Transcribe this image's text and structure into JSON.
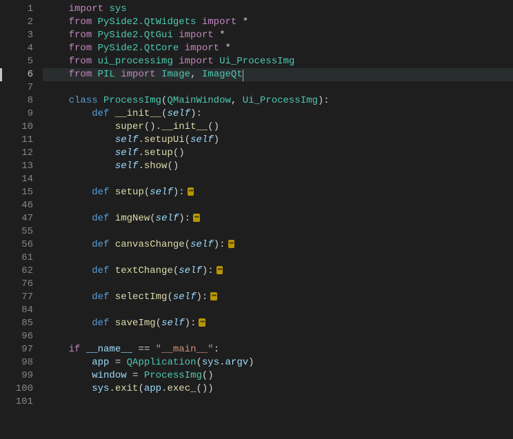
{
  "line_numbers": [
    "1",
    "2",
    "3",
    "4",
    "5",
    "6",
    "7",
    "8",
    "9",
    "10",
    "11",
    "12",
    "13",
    "14",
    "15",
    "46",
    "47",
    "55",
    "56",
    "61",
    "62",
    "76",
    "77",
    "84",
    "85",
    "96",
    "97",
    "98",
    "99",
    "100",
    "101"
  ],
  "current_line_index": 5,
  "fold_marker": "⋯",
  "code": {
    "l1": {
      "kw": "import",
      "mod": "sys"
    },
    "l2": {
      "kw1": "from",
      "mod": "PySide2.QtWidgets",
      "kw2": "import",
      "star": "*"
    },
    "l3": {
      "kw1": "from",
      "mod": "PySide2.QtGui",
      "kw2": "import",
      "star": "*"
    },
    "l4": {
      "kw1": "from",
      "mod": "PySide2.QtCore",
      "kw2": "import",
      "star": "*"
    },
    "l5": {
      "kw1": "from",
      "mod": "ui_processimg",
      "kw2": "import",
      "cls": "Ui_ProcessImg"
    },
    "l6": {
      "kw1": "from",
      "mod": "PIL",
      "kw2": "import",
      "cls1": "Image",
      "cls2": "ImageQt"
    },
    "l8": {
      "kw": "class",
      "name": "ProcessImg",
      "base1": "QMainWindow",
      "base2": "Ui_ProcessImg"
    },
    "l9": {
      "kw": "def",
      "name": "__init__",
      "param": "self"
    },
    "l10": {
      "fn": "super",
      "meth": "__init__"
    },
    "l11": {
      "obj": "self",
      "meth": "setupUi",
      "arg": "self"
    },
    "l12": {
      "obj": "self",
      "meth": "setup"
    },
    "l13": {
      "obj": "self",
      "meth": "show"
    },
    "l15": {
      "kw": "def",
      "name": "setup",
      "param": "self"
    },
    "l47": {
      "kw": "def",
      "name": "imgNew",
      "param": "self"
    },
    "l56": {
      "kw": "def",
      "name": "canvasChange",
      "param": "self"
    },
    "l62": {
      "kw": "def",
      "name": "textChange",
      "param": "self"
    },
    "l77": {
      "kw": "def",
      "name": "selectImg",
      "param": "self"
    },
    "l85": {
      "kw": "def",
      "name": "saveImg",
      "param": "self"
    },
    "l97": {
      "kw": "if",
      "var": "__name__",
      "op": "==",
      "str": "\"__main__\""
    },
    "l98": {
      "var": "app",
      "cls": "QApplication",
      "obj": "sys",
      "attr": "argv"
    },
    "l99": {
      "var": "window",
      "cls": "ProcessImg"
    },
    "l100": {
      "obj": "sys",
      "meth": "exit",
      "arg_obj": "app",
      "arg_meth": "exec_"
    }
  }
}
